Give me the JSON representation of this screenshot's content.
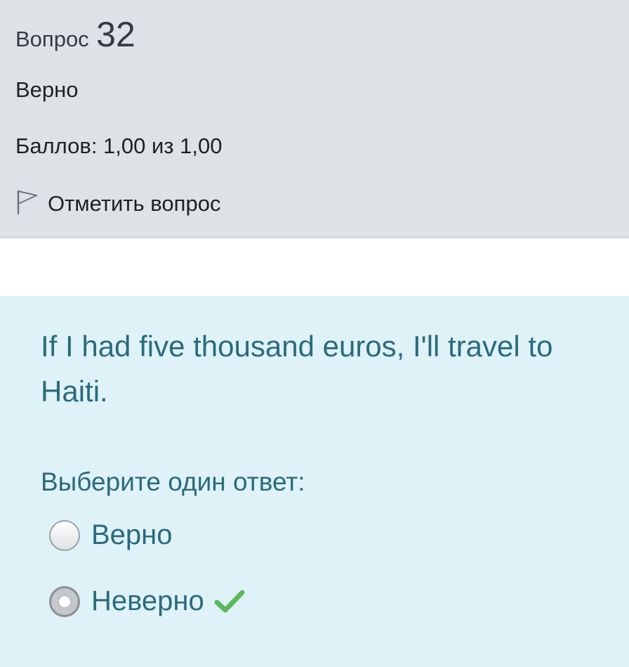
{
  "info": {
    "question_label": "Вопрос",
    "question_number": "32",
    "state": "Верно",
    "grade": "Баллов: 1,00 из 1,00",
    "flag_label": "Отметить вопрос",
    "flag_icon": "flag-outline-icon",
    "background": "#dee2e6"
  },
  "question": {
    "text": "If I had five thousand euros, I'll travel to Haiti.",
    "prompt": "Выберите один ответ:",
    "background": "#def2f8",
    "text_color": "#2b6a7c",
    "answers": [
      {
        "label": "Верно",
        "selected": false,
        "correct_mark": false
      },
      {
        "label": "Неверно",
        "selected": true,
        "correct_mark": true,
        "mark_icon": "checkmark-icon",
        "mark_color": "#5cb85c"
      }
    ]
  }
}
